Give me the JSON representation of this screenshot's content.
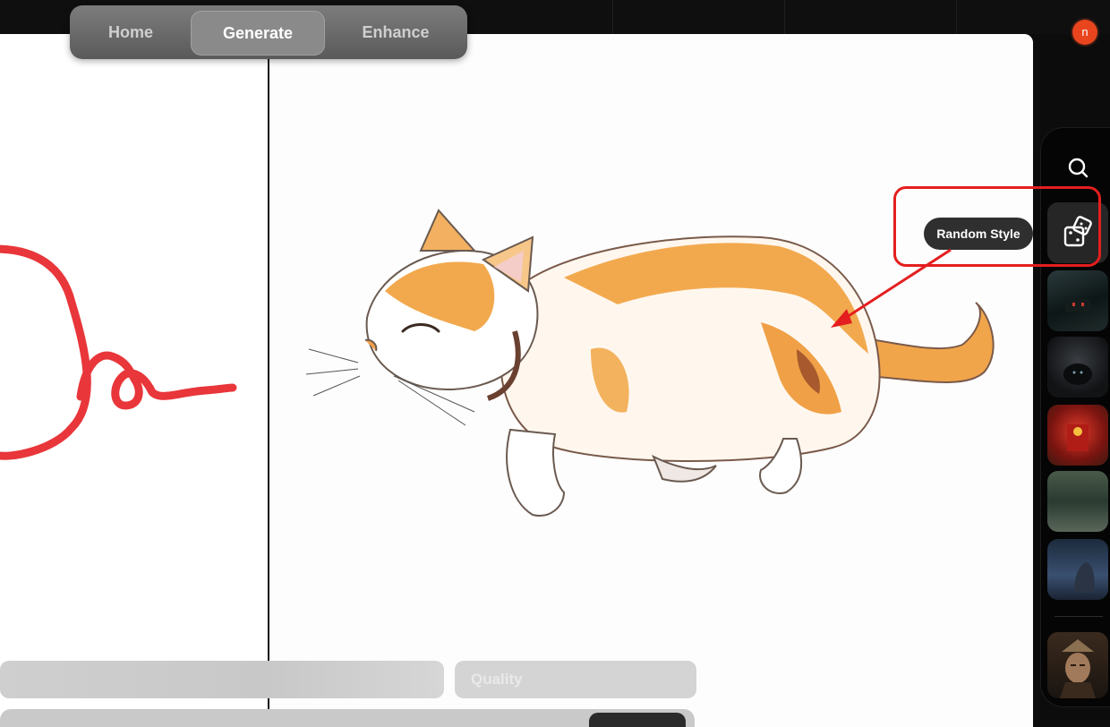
{
  "nav": {
    "tabs": [
      {
        "label": "Home"
      },
      {
        "label": "Generate",
        "active": true
      },
      {
        "label": "Enhance"
      }
    ]
  },
  "user": {
    "avatar_initial": "n",
    "avatar_color": "#e8451e"
  },
  "tooltip": {
    "label": "Random Style"
  },
  "controls": {
    "quality_placeholder": "Quality"
  },
  "sidebar": {
    "icons": [
      "search-icon",
      "dice-icon"
    ],
    "styles": [
      "style-thumbnail-1",
      "style-thumbnail-2",
      "style-thumbnail-3",
      "style-thumbnail-4",
      "style-thumbnail-5",
      "style-thumbnail-6"
    ]
  },
  "annotation": {
    "highlight_color": "#e41e1e"
  }
}
